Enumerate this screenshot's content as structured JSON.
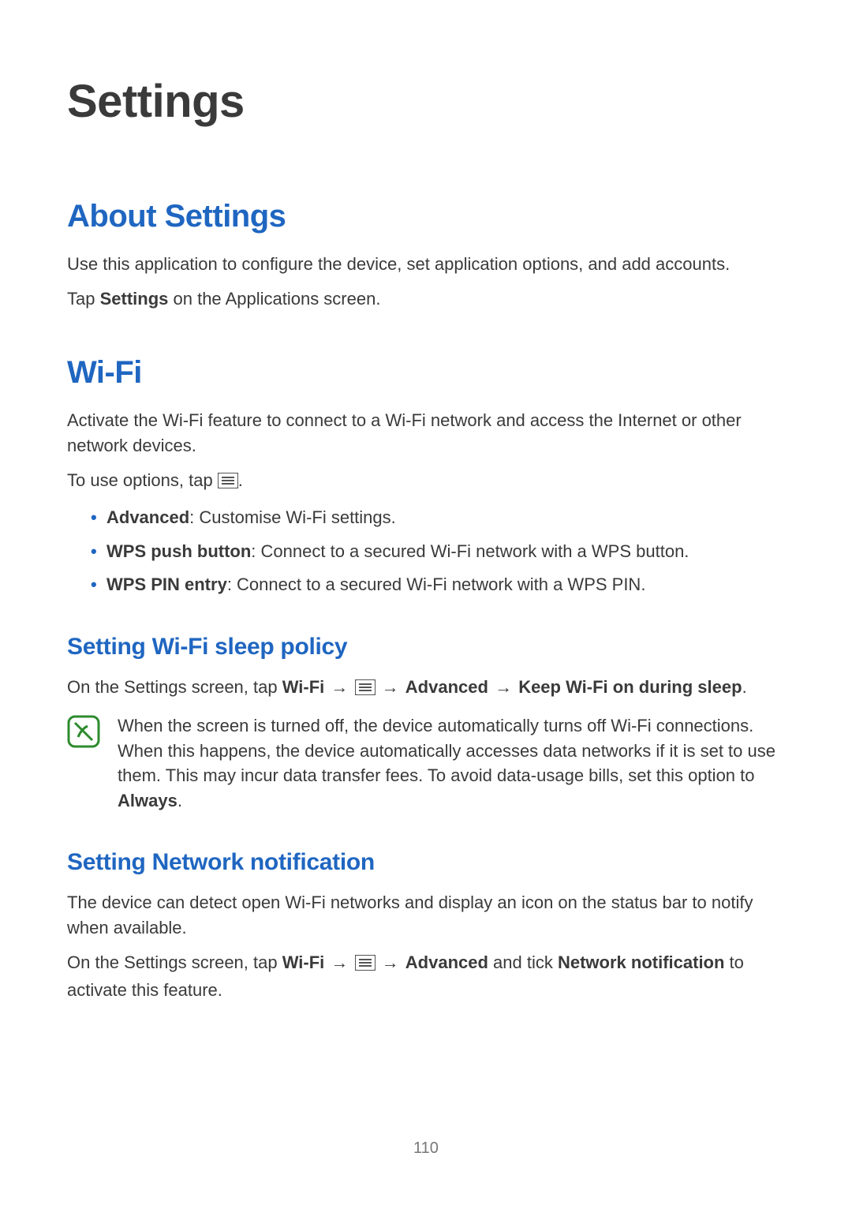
{
  "page": {
    "title": "Settings",
    "number": "110"
  },
  "about": {
    "heading": "About Settings",
    "body1": "Use this application to configure the device, set application options, and add accounts.",
    "body2_prefix": "Tap ",
    "body2_bold": "Settings",
    "body2_suffix": " on the Applications screen."
  },
  "wifi": {
    "heading": "Wi-Fi",
    "body1": "Activate the Wi-Fi feature to connect to a Wi-Fi network and access the Internet or other network devices.",
    "options_prefix": "To use options, tap ",
    "options_suffix": ".",
    "bullets": [
      {
        "label": "Advanced",
        "desc": ": Customise Wi-Fi settings."
      },
      {
        "label": "WPS push button",
        "desc": ": Connect to a secured Wi-Fi network with a WPS button."
      },
      {
        "label": "WPS PIN entry",
        "desc": ": Connect to a secured Wi-Fi network with a WPS PIN."
      }
    ]
  },
  "sleep": {
    "heading": "Setting Wi-Fi sleep policy",
    "line_prefix": "On the Settings screen, tap ",
    "wifi_bold": "Wi-Fi",
    "arrow": "→",
    "advanced_bold": "Advanced",
    "keep_bold": "Keep Wi-Fi on during sleep",
    "line_suffix": ".",
    "note_body": "When the screen is turned off, the device automatically turns off Wi-Fi connections. When this happens, the device automatically accesses data networks if it is set to use them. This may incur data transfer fees. To avoid data-usage bills, set this option to ",
    "note_bold": "Always",
    "note_suffix": "."
  },
  "network": {
    "heading": "Setting Network notification",
    "body1": "The device can detect open Wi-Fi networks and display an icon on the status bar to notify when available.",
    "line_prefix": "On the Settings screen, tap ",
    "wifi_bold": "Wi-Fi",
    "arrow": "→",
    "advanced_bold": "Advanced",
    "mid": " and tick ",
    "net_bold": "Network notification",
    "line_suffix": " to activate this feature."
  }
}
